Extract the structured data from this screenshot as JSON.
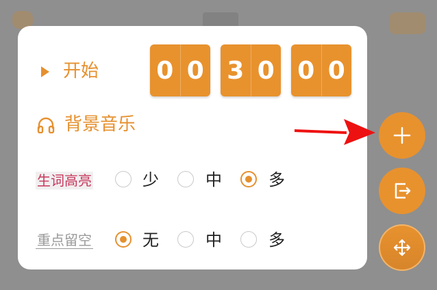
{
  "panel": {
    "start_label": "开始",
    "timer": {
      "groups": [
        [
          "0",
          "0"
        ],
        [
          "3",
          "0"
        ],
        [
          "0",
          "0"
        ]
      ]
    },
    "music_label": "背景音乐",
    "options": [
      {
        "label": "生词高亮",
        "choices": [
          "少",
          "中",
          "多"
        ],
        "selected": "多"
      },
      {
        "label": "重点留空",
        "choices": [
          "无",
          "中",
          "多"
        ],
        "selected": "无"
      }
    ]
  },
  "fabs": [
    "plus-icon",
    "exit-icon",
    "move-icon"
  ],
  "colors": {
    "accent": "#e8922e",
    "highlight_text": "#c8385c",
    "arrow": "#ee1111",
    "backdrop": "#8f8f8f"
  }
}
